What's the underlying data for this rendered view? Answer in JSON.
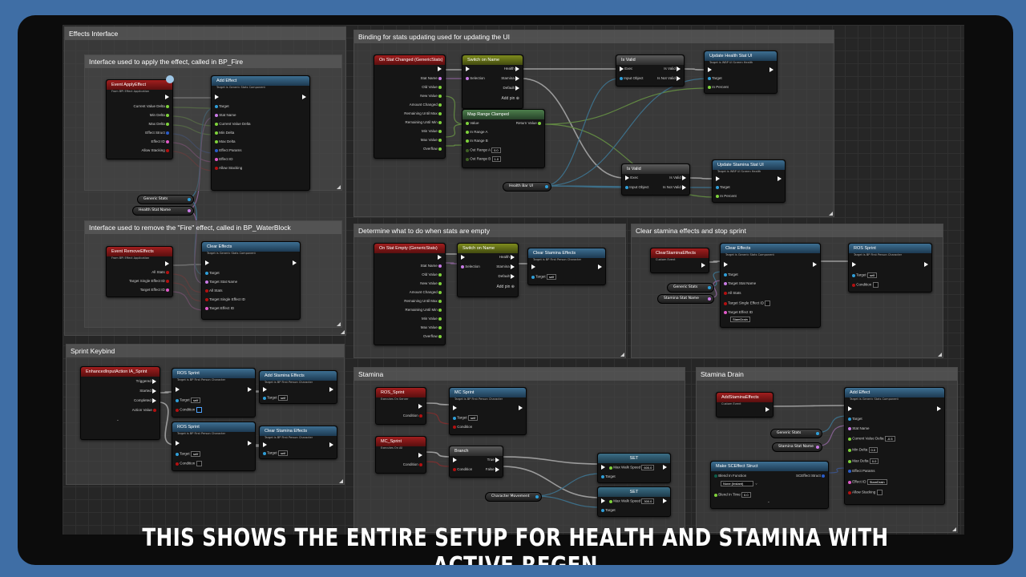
{
  "caption": "THIS SHOWS THE ENTIRE SETUP FOR HEALTH AND STAMINA WITH ACTIVE REGEN",
  "colors": {
    "exec": "#ffffff",
    "float": "#7fd33b",
    "object": "#2f9ed8",
    "name": "#c97be6",
    "struct": "#2a5cc8",
    "bool": "#b31010",
    "byte": "#0c5b4a",
    "text": "#e25ac9"
  },
  "comments": {
    "effects_interface": "Effects Interface",
    "apply_effect": "Interface used to apply the effect, called in BP_Fire",
    "remove_effect": "Interface used to remove the \"Fire\" effect, called in BP_WaterBlock",
    "sprint_keybind": "Sprint Keybind",
    "binding_stats": "Binding for stats updating used for updating the UI",
    "stats_empty": "Determine what to do when stats are empty",
    "clear_stamina": "Clear stamina effects and stop sprint",
    "stamina": "Stamina",
    "stamina_drain": "Stamina Drain"
  },
  "nodes": {
    "event_apply": {
      "title": "Event ApplyEffect",
      "sub": "From BPI Effect Application",
      "pins": [
        "Current Value Delta",
        "Min Delta",
        "Max Delta",
        "Effect Struct",
        "Effect ID",
        "Allow Stacking"
      ]
    },
    "add_effect": {
      "title": "Add Effect",
      "sub": "Target is Generic Stats Component",
      "pins": [
        "Target",
        "Stat Name",
        "Current Value Delta",
        "Min Delta",
        "Max Delta",
        "Effect Params",
        "Effect ID",
        "Allow Stacking"
      ]
    },
    "generic_stats_var": "Generic Stats",
    "health_stat_name_var": "Health Stat Name",
    "event_remove": {
      "title": "Event RemoveEffects",
      "sub": "From BPI Effect Application",
      "pins": [
        "All Stats",
        "Target Single Effect ID",
        "Target Effect ID"
      ]
    },
    "clear_effects": {
      "title": "Clear Effects",
      "sub": "Target is Generic Stats Component",
      "pins": [
        "Target",
        "Target Stat Name",
        "All Stats",
        "Target Single Effect ID",
        "Target Effect ID"
      ]
    },
    "on_stat_changed": {
      "title": "On Stat Changed (GenericStats)",
      "pins": [
        "Stat Name",
        "Old Value",
        "New Value",
        "Amount Changed",
        "Remaining Until Max",
        "Remaining Until Min",
        "Min Value",
        "Max Value",
        "Overflow"
      ]
    },
    "switch_on_name": {
      "title": "Switch on Name",
      "pins": [
        "Selection",
        "Health",
        "Stamina",
        "Default",
        "Add pin"
      ]
    },
    "is_valid_1": {
      "title": "Is Valid",
      "pins": [
        "Exec",
        "Input Object",
        "Is Valid",
        "Is Not Valid"
      ]
    },
    "update_health": {
      "title": "Update Health Stat UI",
      "sub": "Target is WBP UI Screen Health",
      "pins": [
        "Target",
        "In Percent"
      ]
    },
    "map_range": {
      "title": "Map Range Clamped",
      "pins": [
        "Value",
        "In Range A",
        "In Range B",
        "Out Range A",
        "Out Range B",
        "Return Value"
      ],
      "out_a": "0.0",
      "out_b": "1.0"
    },
    "is_valid_2": {
      "title": "Is Valid",
      "pins": [
        "Exec",
        "Input Object",
        "Is Valid",
        "Is Not Valid"
      ]
    },
    "update_stamina": {
      "title": "Update Stamina Stat UI",
      "sub": "Target is WBP UI Screen Health",
      "pins": [
        "Target",
        "In Percent"
      ]
    },
    "health_bar_var": "Health Bar UI",
    "on_stat_empty": {
      "title": "On Stat Empty (GenericStats)",
      "pins": [
        "Stat Name",
        "Old Value",
        "New Value",
        "Amount Changed",
        "Remaining Until Max",
        "Remaining Until Min",
        "Min Value",
        "Max Value",
        "Overflow"
      ]
    },
    "switch_on_name_2": {
      "title": "Switch on Name",
      "pins": [
        "Selection",
        "Health",
        "Stamina",
        "Default",
        "Add pin"
      ]
    },
    "clear_stamina_effects": {
      "title": "Clear Stamina Effects",
      "sub": "Target is BP First Person Character",
      "pins": [
        "Target"
      ],
      "target_val": "self"
    },
    "clear_stamina_event": {
      "title": "ClearStaminaEffects",
      "sub": "Custom Event"
    },
    "clear_effects_2": {
      "title": "Clear Effects",
      "sub": "Target is Generic Stats Component",
      "pins": [
        "Target",
        "Target Stat Name",
        "All Stats",
        "Target Single Effect ID",
        "Target Effect ID"
      ],
      "effect_id": "StamDrain"
    },
    "stamina_stat_name_var": "Stamina Stat Name",
    "ros_sprint_right": {
      "title": "ROS Sprint",
      "sub": "Target is BP First Person Character",
      "pins": [
        "Target",
        "Condition"
      ],
      "target_val": "self"
    },
    "enhanced_input": {
      "title": "EnhancedInputAction IA_Sprint",
      "pins": [
        "Triggered",
        "Started",
        "Completed",
        "Action Value"
      ]
    },
    "ros_sprint_a": {
      "title": "ROS Sprint",
      "sub": "Target is BP First Person Character",
      "pins": [
        "Target",
        "Condition"
      ],
      "target_val": "self"
    },
    "add_stamina_effects": {
      "title": "Add Stamina Effects",
      "sub": "Target is BP First Person Character",
      "pins": [
        "Target"
      ],
      "target_val": "self"
    },
    "ros_sprint_b": {
      "title": "ROS Sprint",
      "sub": "Target is BP First Person Character",
      "pins": [
        "Target",
        "Condition"
      ],
      "target_val": "self"
    },
    "clear_stamina_effects_b": {
      "title": "Clear Stamina Effects",
      "sub": "Target is BP First Person Character",
      "pins": [
        "Target"
      ],
      "target_val": "self"
    },
    "ros_sprint_event": {
      "title": "ROS_Sprint",
      "sub": "Executes On Server",
      "pins": [
        "Condition"
      ]
    },
    "mc_sprint_call": {
      "title": "MC Sprint",
      "sub": "Target is BP First Person Character",
      "pins": [
        "Target",
        "Condition"
      ],
      "target_val": "self"
    },
    "mc_sprint_event": {
      "title": "MC_Sprint",
      "sub": "Executes On All",
      "pins": [
        "Condition"
      ]
    },
    "branch": {
      "title": "Branch",
      "pins": [
        "Condition",
        "True",
        "False"
      ]
    },
    "set_1": {
      "title": "SET",
      "pins": [
        "Max Walk Speed",
        "Target"
      ],
      "val": "600.0"
    },
    "set_2": {
      "title": "SET",
      "pins": [
        "Max Walk Speed",
        "Target"
      ],
      "val": "300.0"
    },
    "char_movement_var": "Character Movement",
    "add_stamina_event": {
      "title": "AddStaminaEffects",
      "sub": "Custom Event"
    },
    "add_effect_2": {
      "title": "Add Effect",
      "sub": "Target is Generic Stats Component",
      "pins": [
        "Target",
        "Stat Name",
        "Current Value Delta",
        "Min Delta",
        "Max Delta",
        "Effect Params",
        "Effect ID",
        "Allow Stacking"
      ],
      "delta": "-0.5",
      "min": "0.0",
      "max": "0.0",
      "effect_id": "StamDrain"
    },
    "make_struct": {
      "title": "Make SCEffect Struct",
      "pins": [
        "Blend In Function",
        "Blend In Time",
        "SCEffect Struct"
      ],
      "blend": "None (Instant)",
      "time": "0.0"
    }
  }
}
